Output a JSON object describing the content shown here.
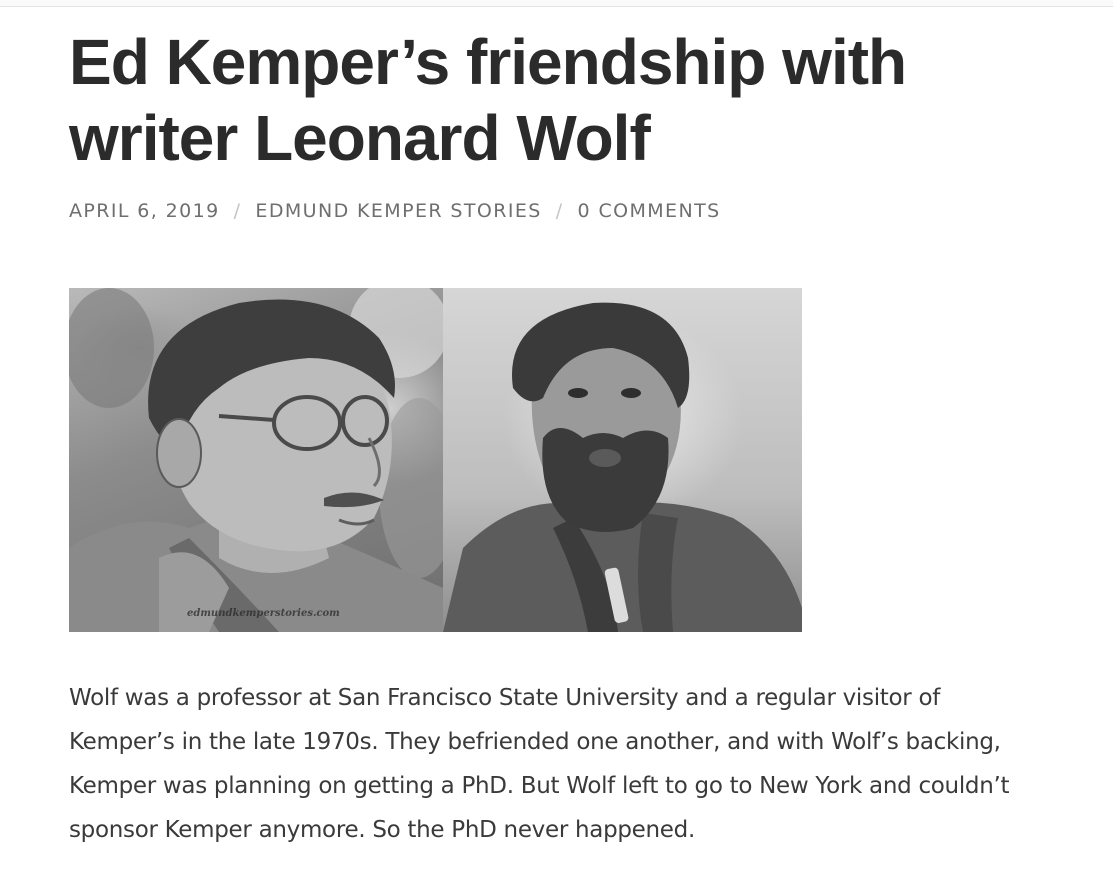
{
  "article": {
    "title": "Ed Kemper’s friendship with writer Leonard Wolf",
    "meta": {
      "date": "APRIL 6, 2019",
      "category": "EDMUND KEMPER STORIES",
      "comments": "0 COMMENTS",
      "separator": "/"
    },
    "images": {
      "left_alt": "Ed Kemper",
      "right_alt": "Leonard Wolf",
      "watermark": "edmundkemperstories.com"
    },
    "body": "Wolf was a professor at San Francisco State University and a regular visitor of Kemper’s in the late 1970s. They befriended one another, and with Wolf’s backing, Kemper was planning on getting a PhD. But Wolf left to go to New York and couldn’t sponsor Kemper anymore. So the PhD never happened."
  }
}
